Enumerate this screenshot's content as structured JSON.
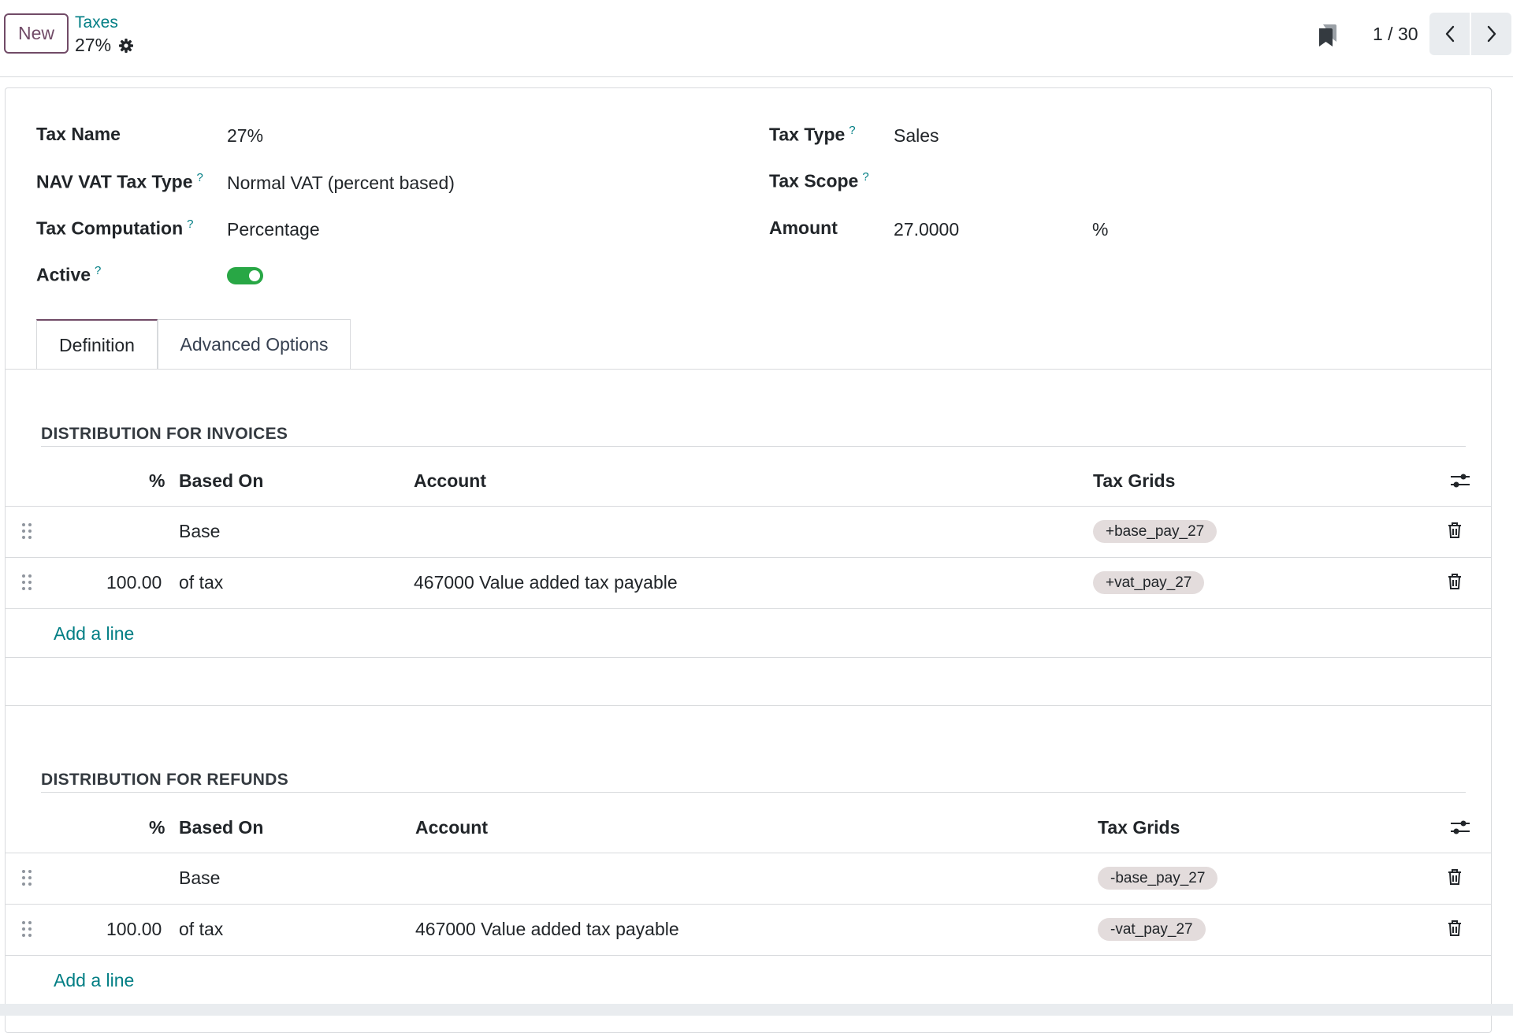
{
  "control_panel": {
    "new_label": "New",
    "breadcrumb_parent": "Taxes",
    "record_title": "27%",
    "pager_value": "1 / 30"
  },
  "form": {
    "left_fields": [
      {
        "label": "Tax Name",
        "help": "",
        "value": "27%"
      },
      {
        "label": "NAV VAT Tax Type",
        "help": "?",
        "value": "Normal VAT (percent based)"
      },
      {
        "label": "Tax Computation",
        "help": "?",
        "value": "Percentage"
      },
      {
        "label": "Active",
        "help": "?",
        "value": ""
      }
    ],
    "right_fields": [
      {
        "label": "Tax Type",
        "help": "?",
        "value": "Sales"
      },
      {
        "label": "Tax Scope",
        "help": "?",
        "value": ""
      },
      {
        "label": "Amount",
        "help": "",
        "value": "27.0000",
        "unit": "%"
      }
    ],
    "active": true
  },
  "tabs": [
    {
      "label": "Definition",
      "active": true
    },
    {
      "label": "Advanced Options",
      "active": false
    }
  ],
  "invoices": {
    "title": "DISTRIBUTION FOR INVOICES",
    "headers": {
      "percent": "%",
      "based_on": "Based On",
      "account": "Account",
      "tax_grids": "Tax Grids"
    },
    "rows": [
      {
        "percent": "",
        "based_on": "Base",
        "account": "",
        "tax_grid": "+base_pay_27"
      },
      {
        "percent": "100.00",
        "based_on": "of tax",
        "account": "467000 Value added tax payable",
        "tax_grid": "+vat_pay_27"
      }
    ],
    "add_line": "Add a line"
  },
  "refunds": {
    "title": "DISTRIBUTION FOR REFUNDS",
    "headers": {
      "percent": "%",
      "based_on": "Based On",
      "account": "Account",
      "tax_grids": "Tax Grids"
    },
    "rows": [
      {
        "percent": "",
        "based_on": "Base",
        "account": "",
        "tax_grid": "-base_pay_27"
      },
      {
        "percent": "100.00",
        "based_on": "of tax",
        "account": "467000 Value added tax payable",
        "tax_grid": "-vat_pay_27"
      }
    ],
    "add_line": "Add a line"
  },
  "colors": {
    "brand": "#714b67",
    "link": "#017e84",
    "toggle_on": "#28a745",
    "tag_bg": "#e3dcdc"
  },
  "icons": [
    "gear-icon",
    "bookmark-icon",
    "chevron-left-icon",
    "chevron-right-icon",
    "drag-handle-icon",
    "trash-icon",
    "optional-columns-icon"
  ]
}
